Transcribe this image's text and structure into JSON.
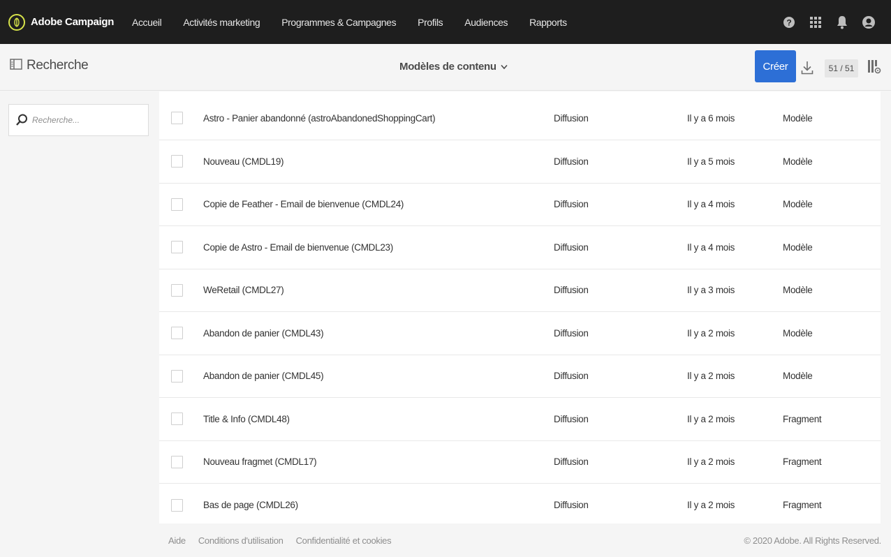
{
  "app": {
    "name": "Adobe Campaign",
    "accent": "#2d6fd6",
    "logo_accent": "#d7e34a"
  },
  "nav": {
    "items": [
      {
        "label": "Accueil"
      },
      {
        "label": "Activités marketing"
      },
      {
        "label": "Programmes & Campagnes"
      },
      {
        "label": "Profils"
      },
      {
        "label": "Audiences"
      },
      {
        "label": "Rapports"
      }
    ],
    "icons": [
      "help-icon",
      "apps-grid-icon",
      "bell-icon",
      "user-avatar-icon"
    ]
  },
  "toolbar": {
    "search_title": "Recherche",
    "view_label": "Modèles de contenu",
    "create_label": "Créer",
    "count": "51 / 51"
  },
  "search": {
    "placeholder": "Recherche..."
  },
  "table": {
    "rows": [
      {
        "name": "Astro - Panier abandonné (astroAbandonedShoppingCart)",
        "type": "Diffusion",
        "date": "Il y a 6 mois",
        "kind": "Modèle"
      },
      {
        "name": "Nouveau (CMDL19)",
        "type": "Diffusion",
        "date": "Il y a 5 mois",
        "kind": "Modèle"
      },
      {
        "name": "Copie de Feather - Email de bienvenue (CMDL24)",
        "type": "Diffusion",
        "date": "Il y a 4 mois",
        "kind": "Modèle"
      },
      {
        "name": "Copie de Astro - Email de bienvenue (CMDL23)",
        "type": "Diffusion",
        "date": "Il y a 4 mois",
        "kind": "Modèle"
      },
      {
        "name": "WeRetail (CMDL27)",
        "type": "Diffusion",
        "date": "Il y a 3 mois",
        "kind": "Modèle"
      },
      {
        "name": "Abandon de panier (CMDL43)",
        "type": "Diffusion",
        "date": "Il y a 2 mois",
        "kind": "Modèle"
      },
      {
        "name": "Abandon de panier (CMDL45)",
        "type": "Diffusion",
        "date": "Il y a 2 mois",
        "kind": "Modèle"
      },
      {
        "name": "Title & Info (CMDL48)",
        "type": "Diffusion",
        "date": "Il y a 2 mois",
        "kind": "Fragment"
      },
      {
        "name": "Nouveau fragmet (CMDL17)",
        "type": "Diffusion",
        "date": "Il y a 2 mois",
        "kind": "Fragment"
      },
      {
        "name": "Bas de page (CMDL26)",
        "type": "Diffusion",
        "date": "Il y a 2 mois",
        "kind": "Fragment"
      }
    ]
  },
  "footer": {
    "links": [
      {
        "label": "Aide"
      },
      {
        "label": "Conditions d'utilisation"
      },
      {
        "label": "Confidentialité et cookies"
      }
    ],
    "copyright": "© 2020 Adobe. All Rights Reserved."
  }
}
